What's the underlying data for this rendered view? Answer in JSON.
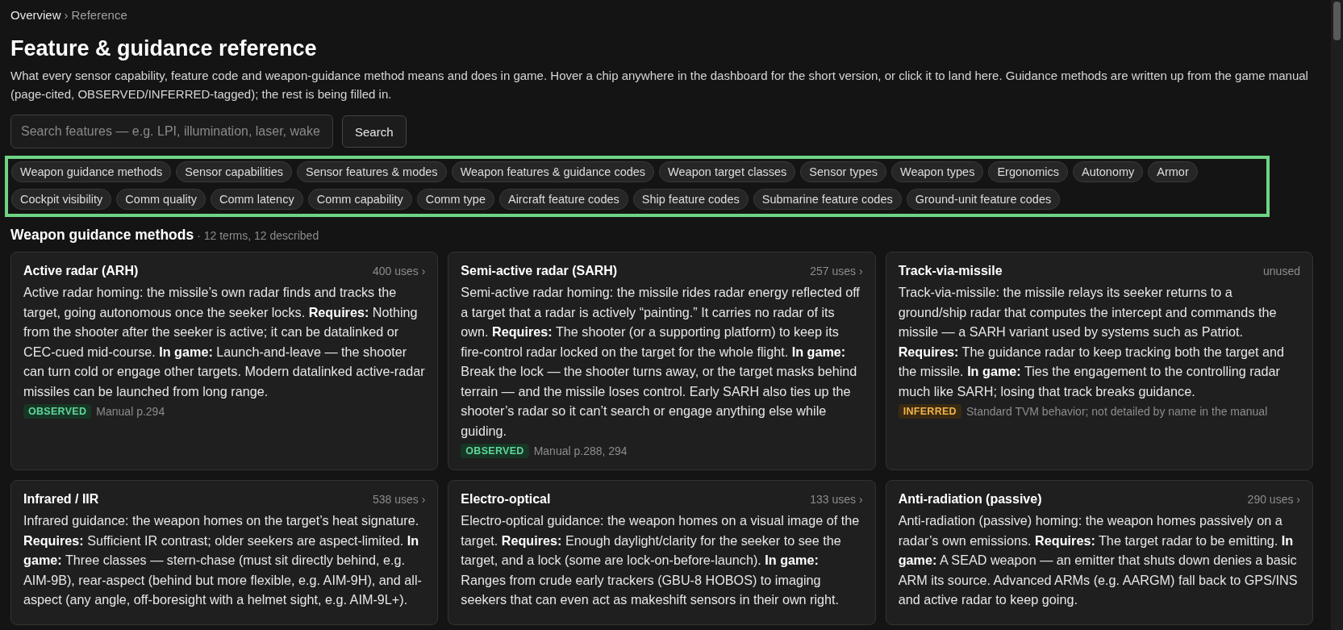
{
  "breadcrumb": [
    {
      "label": "Overview",
      "current": false
    },
    {
      "label": "Reference",
      "current": true
    }
  ],
  "breadcrumb_separator": "›",
  "title": "Feature & guidance reference",
  "intro": "What every sensor capability, feature code and weapon-guidance method means and does in game. Hover a chip anywhere in the dashboard for the short version, or click it to land here. Guidance methods are written up from the game manual (page-cited, OBSERVED/INFERRED-tagged); the rest is being filled in.",
  "search": {
    "placeholder": "Search features — e.g. LPI, illumination, laser, wake",
    "button": "Search"
  },
  "chip_rows": [
    [
      "Weapon guidance methods",
      "Sensor capabilities",
      "Sensor features & modes",
      "Weapon features & guidance codes",
      "Weapon target classes",
      "Sensor types",
      "Weapon types",
      "Ergonomics",
      "Autonomy",
      "Armor"
    ],
    [
      "Cockpit visibility",
      "Comm quality",
      "Comm latency",
      "Comm capability",
      "Comm type",
      "Aircraft feature codes",
      "Ship feature codes",
      "Submarine feature codes",
      "Ground-unit feature codes"
    ]
  ],
  "section": {
    "title": "Weapon guidance methods",
    "meta": "· 12 terms, 12 described"
  },
  "cards": [
    {
      "title": "Active radar (ARH)",
      "uses": "400 uses ›",
      "text": "Active radar homing: the missile’s own radar finds and tracks the target, going autonomous once the seeker locks. **Requires:** Nothing from the shooter after the seeker is active; it can be datalinked or CEC-cued mid-course. **In game:** Launch-and-leave — the shooter can turn cold or engage other targets. Modern datalinked active-radar missiles can be launched from long range.",
      "kind": "observed",
      "tag": "OBSERVED",
      "source": "Manual p.294"
    },
    {
      "title": "Semi-active radar (SARH)",
      "uses": "257 uses ›",
      "text": "Semi-active radar homing: the missile rides radar energy reflected off a target that a radar is actively “painting.” It carries no radar of its own. **Requires:** The shooter (or a supporting platform) to keep its fire-control radar locked on the target for the whole flight. **In game:** Break the lock — the shooter turns away, or the target masks behind terrain — and the missile loses control. Early SARH also ties up the shooter’s radar so it can’t search or engage anything else while guiding.",
      "kind": "observed",
      "tag": "OBSERVED",
      "source": "Manual p.288, 294"
    },
    {
      "title": "Track-via-missile",
      "uses": "unused",
      "text": "Track-via-missile: the missile relays its seeker returns to a ground/ship radar that computes the intercept and commands the missile — a SARH variant used by systems such as Patriot. **Requires:** The guidance radar to keep tracking both the target and the missile. **In game:** Ties the engagement to the controlling radar much like SARH; losing that track breaks guidance.",
      "kind": "inferred",
      "tag": "INFERRED",
      "source": "Standard TVM behavior; not detailed by name in the manual"
    },
    {
      "title": "Infrared / IIR",
      "uses": "538 uses ›",
      "text": "Infrared guidance: the weapon homes on the target’s heat signature. **Requires:** Sufficient IR contrast; older seekers are aspect-limited. **In game:** Three classes — stern-chase (must sit directly behind, e.g. AIM-9B), rear-aspect (behind but more flexible, e.g. AIM-9H), and all-aspect (any angle, off-boresight with a helmet sight, e.g. AIM-9L+)."
    },
    {
      "title": "Electro-optical",
      "uses": "133 uses ›",
      "text": "Electro-optical guidance: the weapon homes on a visual image of the target. **Requires:** Enough daylight/clarity for the seeker to see the target, and a lock (some are lock-on-before-launch). **In game:** Ranges from crude early trackers (GBU-8 HOBOS) to imaging seekers that can even act as makeshift sensors in their own right."
    },
    {
      "title": "Anti-radiation (passive)",
      "uses": "290 uses ›",
      "text": "Anti-radiation (passive) homing: the weapon homes passively on a radar’s own emissions. **Requires:** The target radar to be emitting. **In game:** A SEAD weapon — an emitter that shuts down denies a basic ARM its source. Advanced ARMs (e.g. AARGM) fall back to GPS/INS and active radar to keep going."
    }
  ]
}
